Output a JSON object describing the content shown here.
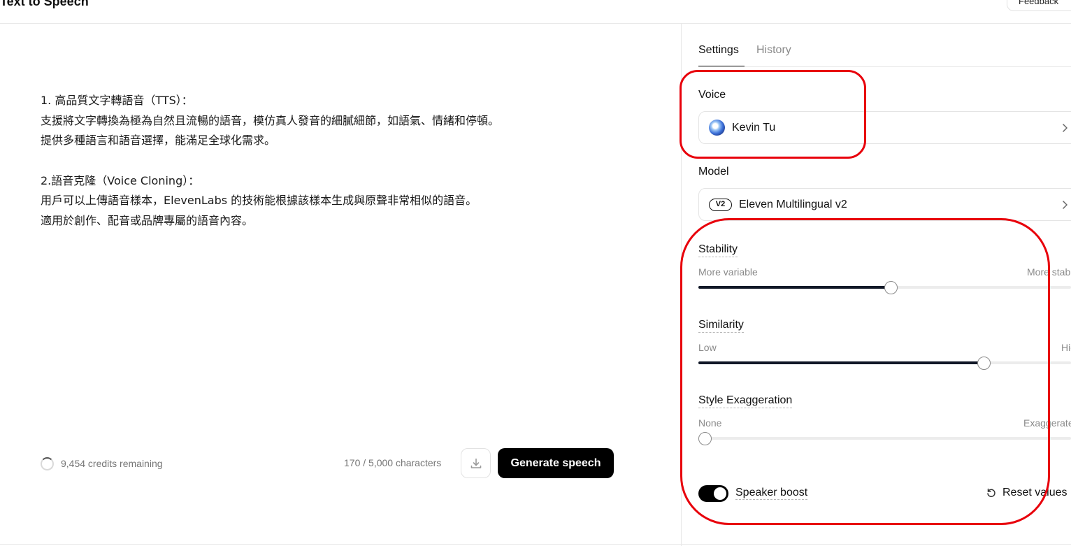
{
  "header": {
    "title": "Text to Speech",
    "feedback_label": "Feedback"
  },
  "editor": {
    "lines": [
      "1. 高品質文字轉語音（TTS）：",
      "支援將文字轉換為極為自然且流暢的語音，模仿真人發音的細膩細節，如語氣、情緒和停頓。",
      "提供多種語言和語音選擇，能滿足全球化需求。",
      "2.語音克隆（Voice Cloning）：",
      "用戶可以上傳語音樣本，ElevenLabs 的技術能根據該樣本生成與原聲非常相似的語音。",
      "適用於創作、配音或品牌專屬的語音內容。"
    ]
  },
  "footer": {
    "credits": "9,454 credits remaining",
    "char_count": "170 / 5,000 characters",
    "generate_label": "Generate speech"
  },
  "tabs": {
    "settings": "Settings",
    "history": "History"
  },
  "voice": {
    "label": "Voice",
    "name": "Kevin Tu"
  },
  "model": {
    "label": "Model",
    "badge": "V2",
    "name": "Eleven Multilingual v2"
  },
  "sliders": {
    "stability": {
      "label": "Stability",
      "min_hint": "More variable",
      "max_hint": "More stable",
      "value": 0.516
    },
    "similarity": {
      "label": "Similarity",
      "min_hint": "Low",
      "max_hint": "High",
      "value": 0.766
    },
    "style": {
      "label": "Style Exaggeration",
      "min_hint": "None",
      "max_hint": "Exaggerated",
      "value": 0.0
    }
  },
  "speaker_boost": {
    "label": "Speaker boost",
    "on": true
  },
  "reset_label": "Reset values",
  "colors": {
    "accent": "#000000",
    "slider_fill": "#111827",
    "annotation": "#e8000b"
  },
  "icons": [
    "download-icon",
    "chevron-right-icon",
    "reset-icon",
    "voice-avatar-icon"
  ]
}
